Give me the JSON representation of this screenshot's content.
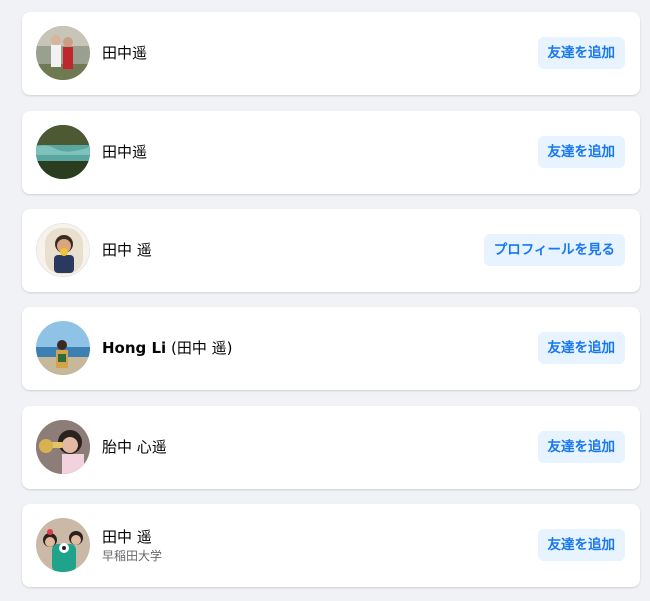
{
  "results": [
    {
      "name": "田中遥",
      "button": "友達を追加",
      "avatar_icon": "profile-photo-couple"
    },
    {
      "name": "田中遥",
      "button": "友達を追加",
      "avatar_icon": "profile-photo-lake"
    },
    {
      "name": "田中 遥",
      "button": "プロフィールを見る",
      "avatar_icon": "profile-photo-girl"
    },
    {
      "name_bold": "Hong Li",
      "name_rest": " (田中 遥)",
      "button": "友達を追加",
      "avatar_icon": "profile-photo-beach"
    },
    {
      "name": "胎中 心遥",
      "button": "友達を追加",
      "avatar_icon": "profile-photo-trumpet"
    },
    {
      "name": "田中 遥",
      "subtitle": "早稲田大学",
      "button": "友達を追加",
      "avatar_icon": "profile-photo-group"
    }
  ],
  "colors": {
    "page_background": "#f0f2f5",
    "card_background": "#ffffff",
    "button_background": "#e7f3ff",
    "button_text": "#1877f2",
    "name_text": "#050505",
    "subtitle_text": "#65676b"
  }
}
